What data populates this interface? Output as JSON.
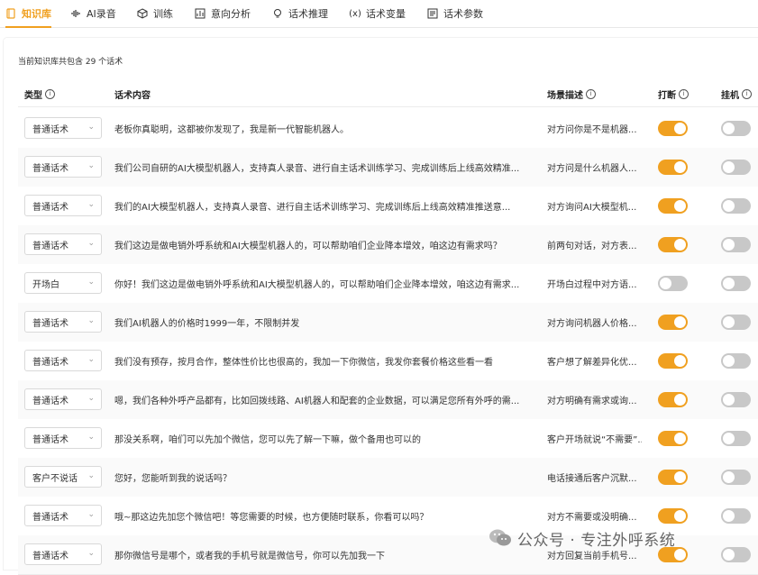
{
  "tabs": [
    {
      "label": "知识库",
      "icon": "book-icon",
      "active": true
    },
    {
      "label": "AI录音",
      "icon": "waveform-icon",
      "active": false
    },
    {
      "label": "训练",
      "icon": "cube-icon",
      "active": false
    },
    {
      "label": "意向分析",
      "icon": "chart-icon",
      "active": false
    },
    {
      "label": "话术推理",
      "icon": "bulb-icon",
      "active": false
    },
    {
      "label": "话术变量",
      "icon": "variable-icon",
      "active": false
    },
    {
      "label": "话术参数",
      "icon": "params-icon",
      "active": false
    }
  ],
  "summary": "当前知识库共包含 29 个话术",
  "table": {
    "headers": {
      "type": "类型",
      "content": "话术内容",
      "scene": "场景描述",
      "interrupt": "打断",
      "hangup": "挂机"
    },
    "rows": [
      {
        "type": "普通话术",
        "content": "老板你真聪明，这都被你发现了，我是新一代智能机器人。",
        "scene": "对方问你是不是机器...",
        "interrupt": true,
        "hangup": false
      },
      {
        "type": "普通话术",
        "content": "我们公司自研的AI大模型机器人，支持真人录音、进行自主话术训练学习、完成训练后上线高效精准...",
        "scene": "对方问是什么机器人...",
        "interrupt": true,
        "hangup": false
      },
      {
        "type": "普通话术",
        "content": "我们的AI大模型机器人，支持真人录音、进行自主话术训练学习、完成训练后上线高效精准推送意...",
        "scene": "对方询问AI大模型机...",
        "interrupt": true,
        "hangup": false
      },
      {
        "type": "普通话术",
        "content": "我们这边是做电销外呼系统和AI大模型机器人的，可以帮助咱们企业降本增效，咱这边有需求吗？",
        "scene": "前两句对话，对方表...",
        "interrupt": true,
        "hangup": false
      },
      {
        "type": "开场白",
        "content": "你好！我们这边是做电销外呼系统和AI大模型机器人的，可以帮助咱们企业降本增效，咱这边有需求...",
        "scene": "开场白过程中对方语...",
        "interrupt": false,
        "hangup": false
      },
      {
        "type": "普通话术",
        "content": "我们AI机器人的价格时1999一年，不限制并发",
        "scene": "对方询问机器人价格...",
        "interrupt": true,
        "hangup": false
      },
      {
        "type": "普通话术",
        "content": "我们没有预存，按月合作，整体性价比也很高的，我加一下你微信，我发你套餐价格这些看一看",
        "scene": "客户想了解差异化优...",
        "interrupt": true,
        "hangup": false
      },
      {
        "type": "普通话术",
        "content": "嗯，我们各种外呼产品都有，比如回拨线路、AI机器人和配套的企业数据，可以满足您所有外呼的需...",
        "scene": "对方明确有需求或询...",
        "interrupt": true,
        "hangup": false
      },
      {
        "type": "普通话术",
        "content": "那没关系啊，咱们可以先加个微信，您可以先了解一下嘛，做个备用也可以的",
        "scene": "客户开场就说“不需要”...",
        "interrupt": true,
        "hangup": false
      },
      {
        "type": "客户不说话",
        "content": "您好，您能听到我的说话吗？",
        "scene": "电话接通后客户沉默...",
        "interrupt": true,
        "hangup": false
      },
      {
        "type": "普通话术",
        "content": "哦~那这边先加您个微信吧！等您需要的时候，也方便随时联系，你看可以吗？",
        "scene": "对方不需要或没明确...",
        "interrupt": true,
        "hangup": false
      },
      {
        "type": "普通话术",
        "content": "那你微信号是哪个，或者我的手机号就是微信号，你可以先加我一下",
        "scene": "对方回复当前手机号...",
        "interrupt": true,
        "hangup": false
      }
    ]
  },
  "watermark": "公众号 · 专注外呼系统",
  "colors": {
    "accent": "#f0a020",
    "toggle_off": "#c8c8c8",
    "border": "#d9d9d9"
  }
}
